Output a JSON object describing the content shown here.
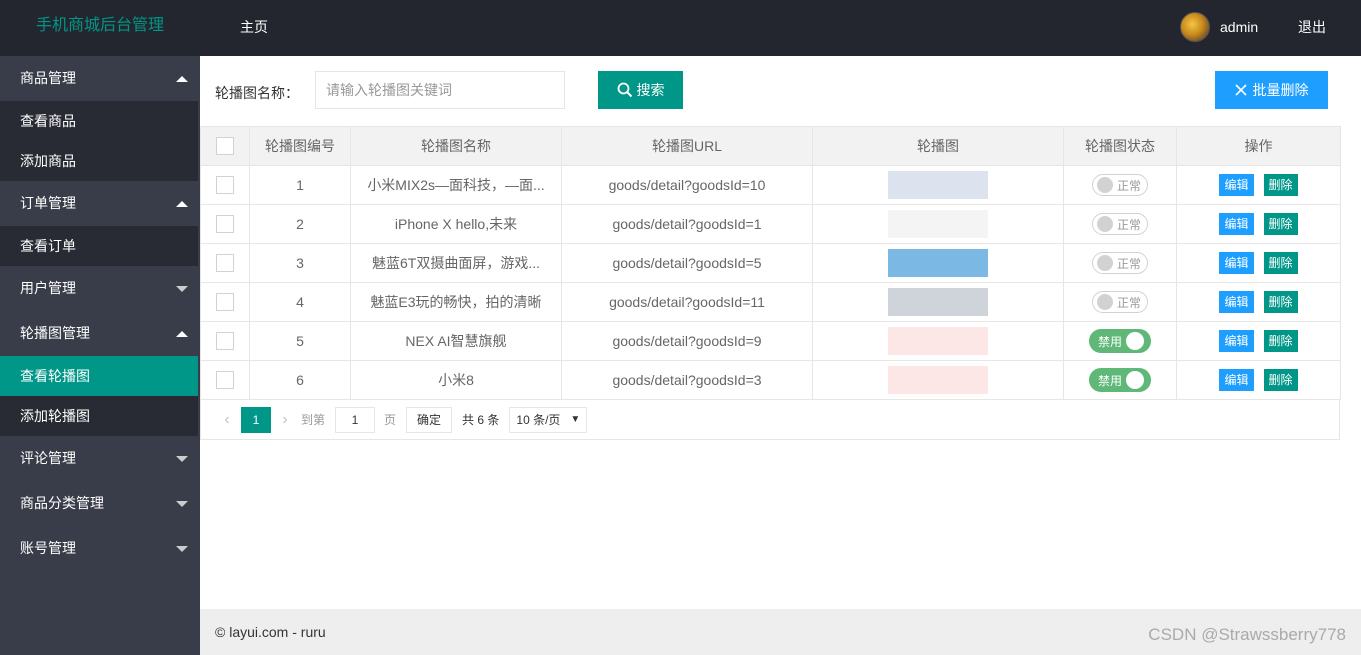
{
  "header": {
    "logo": "手机商城后台管理",
    "nav_home": "主页",
    "username": "admin",
    "logout": "退出"
  },
  "sidebar": {
    "groups": [
      {
        "label": "商品管理",
        "items": [
          "查看商品",
          "添加商品"
        ]
      },
      {
        "label": "订单管理",
        "items": [
          "查看订单"
        ]
      },
      {
        "label": "用户管理"
      },
      {
        "label": "轮播图管理",
        "items": [
          "查看轮播图",
          "添加轮播图"
        ]
      },
      {
        "label": "评论管理"
      },
      {
        "label": "商品分类管理"
      },
      {
        "label": "账号管理"
      }
    ]
  },
  "search": {
    "label": "轮播图名称：",
    "placeholder": "请输入轮播图关键词",
    "button": "搜索",
    "batch_delete": "批量删除"
  },
  "table": {
    "columns": [
      "轮播图编号",
      "轮播图名称",
      "轮播图URL",
      "轮播图",
      "轮播图状态",
      "操作"
    ],
    "edit_label": "编辑",
    "delete_label": "删除",
    "rows": [
      {
        "id": "1",
        "name": "小米MIX2s—面科技，—面...",
        "url": "goods/detail?goodsId=10",
        "status": "正常",
        "thumb_color": "#dde3ee"
      },
      {
        "id": "2",
        "name": "iPhone X hello,未来",
        "url": "goods/detail?goodsId=1",
        "status": "正常",
        "thumb_color": "#f4f4f4"
      },
      {
        "id": "3",
        "name": "魅蓝6T双摄曲面屏，游戏...",
        "url": "goods/detail?goodsId=5",
        "status": "正常",
        "thumb_color": "#7bb8e3"
      },
      {
        "id": "4",
        "name": "魅蓝E3玩的畅快，拍的清晰",
        "url": "goods/detail?goodsId=11",
        "status": "正常",
        "thumb_color": "#cfd3da"
      },
      {
        "id": "5",
        "name": "NEX AI智慧旗舰",
        "url": "goods/detail?goodsId=9",
        "status": "禁用",
        "thumb_color": "#fde6e6"
      },
      {
        "id": "6",
        "name": "小米8",
        "url": "goods/detail?goodsId=3",
        "status": "禁用",
        "thumb_color": "#fde6e6"
      }
    ]
  },
  "pager": {
    "current": "1",
    "goto_label": "到第",
    "goto_value": "1",
    "page_label": "页",
    "confirm": "确定",
    "total": "共 6 条",
    "page_size": "10 条/页"
  },
  "footer": {
    "text": "© layui.com - ruru",
    "watermark": "CSDN @Strawssberry778"
  },
  "colors": {
    "header_bg": "#23262e",
    "sidebar_bg": "#393d49",
    "accent": "#009688",
    "blue": "#1e9fff",
    "switch_on": "#5FB878"
  }
}
